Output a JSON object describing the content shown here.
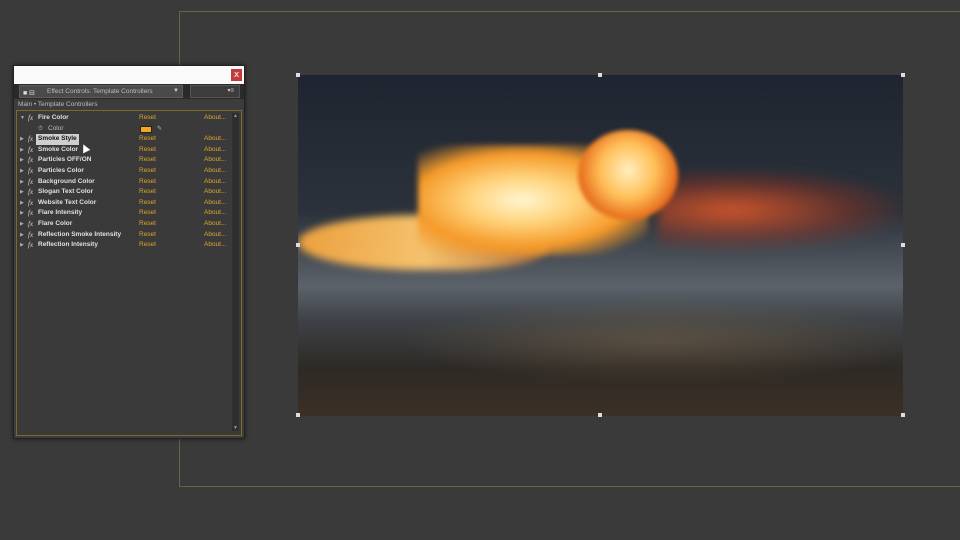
{
  "panel": {
    "title": "",
    "close_glyph": "x",
    "tab_label": "Effect Controls: Template Controllers",
    "tab_dropdown_glyph": "▼",
    "menu_glyph": "▾≡",
    "breadcrumb": "Main • Template Controllers",
    "effects": [
      {
        "name": "Fire Color",
        "reset": "Reset",
        "about": "About...",
        "expanded": true
      },
      {
        "name": "Smoke Style",
        "reset": "Reset",
        "about": "About...",
        "selected": true
      },
      {
        "name": "Smoke Color",
        "reset": "Reset",
        "about": "About..."
      },
      {
        "name": "Particles OFF/ON",
        "reset": "Reset",
        "about": "About..."
      },
      {
        "name": "Particles Color",
        "reset": "Reset",
        "about": "About..."
      },
      {
        "name": "Background Color",
        "reset": "Reset",
        "about": "About..."
      },
      {
        "name": "Slogan Text Color",
        "reset": "Reset",
        "about": "About..."
      },
      {
        "name": "Website Text Color",
        "reset": "Reset",
        "about": "About..."
      },
      {
        "name": "Flare Intensity",
        "reset": "Reset",
        "about": "About..."
      },
      {
        "name": "Flare Color",
        "reset": "Reset",
        "about": "About..."
      },
      {
        "name": "Reflection Smoke Intensity",
        "reset": "Reset",
        "about": "About..."
      },
      {
        "name": "Reflection Intensity",
        "reset": "Reset",
        "about": "About..."
      }
    ],
    "fire_color_property": {
      "label": "Color",
      "swatch_color": "#f5a623"
    }
  },
  "colors": {
    "accent": "#e0a42b",
    "close": "#c43b3b",
    "background": "#3a3a3a"
  }
}
